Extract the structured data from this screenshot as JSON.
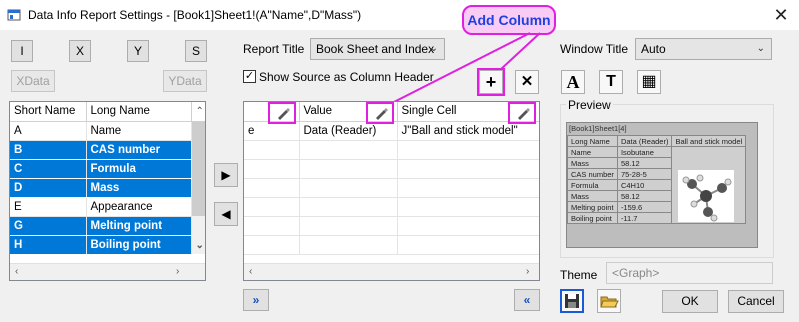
{
  "window": {
    "title": "Data Info Report Settings - [Book1]Sheet1!(A\"Name\",D\"Mass\")",
    "close": "✕"
  },
  "callout": {
    "label": "Add Column"
  },
  "axis_buttons": [
    "I",
    "X",
    "Y",
    "S"
  ],
  "xdata_label": "XData",
  "ydata_label": "YData",
  "columns_list": {
    "headers": [
      "Short Name",
      "Long Name"
    ],
    "rows": [
      {
        "short": "A",
        "long": "Name",
        "selected": false
      },
      {
        "short": "B",
        "long": "CAS number",
        "selected": true
      },
      {
        "short": "C",
        "long": "Formula",
        "selected": true
      },
      {
        "short": "D",
        "long": "Mass",
        "selected": true
      },
      {
        "short": "E",
        "long": "Appearance",
        "selected": false
      },
      {
        "short": "G",
        "long": "Melting point",
        "selected": true
      },
      {
        "short": "H",
        "long": "Boiling point",
        "selected": true
      }
    ]
  },
  "move_right": "▶",
  "move_left": "◀",
  "report_title": {
    "label": "Report Title",
    "value": "Book Sheet and Index"
  },
  "show_source": {
    "label": "Show Source as Column Header",
    "checked": "✓"
  },
  "add_col": "+",
  "remove_col": "✕",
  "report_grid": {
    "headers": [
      "",
      "Value",
      "Single Cell"
    ],
    "first_row": [
      "e",
      "Data (Reader)",
      "J\"Ball and stick model\""
    ]
  },
  "expand_btn": "»",
  "collapse_btn": "«",
  "window_title": {
    "label": "Window Title",
    "value": "Auto"
  },
  "format_tools": [
    "A",
    "T",
    "▦"
  ],
  "preview": {
    "label": "Preview",
    "sheet": "[Book1]Sheet1[4]",
    "header": [
      "Long Name",
      "Data (Reader)",
      "Ball and stick model"
    ],
    "rows": [
      [
        "Name",
        "Isobutane"
      ],
      [
        "Mass",
        "58.12"
      ],
      [
        "CAS number",
        "75-28-5"
      ],
      [
        "Formula",
        "C4H10"
      ],
      [
        "Mass",
        "58.12"
      ],
      [
        "Melting point",
        "-159.6"
      ],
      [
        "Boiling point",
        "-11.7"
      ]
    ]
  },
  "theme": {
    "label": "Theme",
    "value": "<Graph>"
  },
  "ok": "OK",
  "cancel": "Cancel"
}
